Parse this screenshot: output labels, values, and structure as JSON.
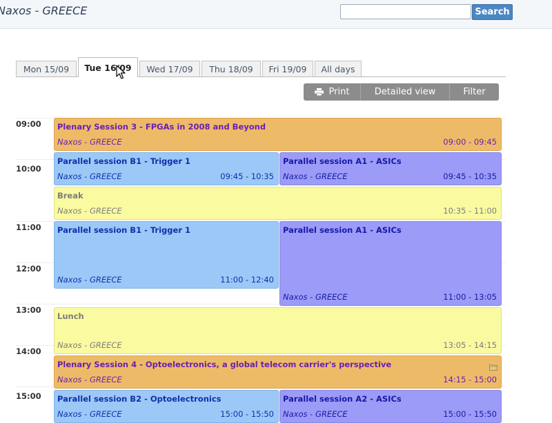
{
  "header": {
    "title": "Naxos - GREECE",
    "search": {
      "value": "",
      "placeholder": ""
    },
    "search_button": "Search"
  },
  "tabs": [
    {
      "label": "Mon 15/09",
      "active": false
    },
    {
      "label": "Tue 16/09",
      "active": true
    },
    {
      "label": "Wed 17/09",
      "active": false
    },
    {
      "label": "Thu 18/09",
      "active": false
    },
    {
      "label": "Fri 19/09",
      "active": false
    },
    {
      "label": "All days",
      "active": false
    }
  ],
  "toolbar": {
    "print": "Print",
    "detailed_view": "Detailed view",
    "filter": "Filter"
  },
  "hours": [
    "09:00",
    "10:00",
    "11:00",
    "12:00",
    "13:00",
    "14:00",
    "15:00"
  ],
  "events": [
    {
      "title": "Plenary Session 3 - FPGAs in 2008 and Beyond",
      "room": "Naxos - GREECE",
      "time": "09:00 - 09:45",
      "kind": "plenary"
    },
    {
      "title": "Parallel session B1 - Trigger 1",
      "room": "Naxos - GREECE",
      "time": "09:45 - 10:35",
      "kind": "blue"
    },
    {
      "title": "Parallel session A1 - ASICs",
      "room": "Naxos - GREECE",
      "time": "09:45 - 10:35",
      "kind": "purple"
    },
    {
      "title": "Break",
      "room": "Naxos - GREECE",
      "time": "10:35 - 11:00",
      "kind": "break"
    },
    {
      "title": "Parallel session B1 - Trigger 1",
      "room": "Naxos - GREECE",
      "time": "11:00 - 12:40",
      "kind": "blue"
    },
    {
      "title": "Parallel session A1 - ASICs",
      "room": "Naxos - GREECE",
      "time": "11:00 - 13:05",
      "kind": "purple"
    },
    {
      "title": "Lunch",
      "room": "Naxos - GREECE",
      "time": "13:05 - 14:15",
      "kind": "break"
    },
    {
      "title": "Plenary Session 4 - Optoelectronics, a global telecom carrier's perspective",
      "room": "Naxos - GREECE",
      "time": "14:15 - 15:00",
      "kind": "plenary",
      "icon": "folder-icon"
    },
    {
      "title": "Parallel session B2 - Optoelectronics",
      "room": "Naxos - GREECE",
      "time": "15:00 - 15:50",
      "kind": "blue"
    },
    {
      "title": "Parallel session A2 - ASICs",
      "room": "Naxos - GREECE",
      "time": "15:00 - 15:50",
      "kind": "purple"
    }
  ],
  "colors": {
    "plenary": "#edbb68",
    "parallel_b": "#9cc8f8",
    "parallel_a": "#9c9cf8",
    "break": "#fafaa0",
    "search_button": "#4b88c4",
    "toolbar": "#8c8c8c"
  }
}
